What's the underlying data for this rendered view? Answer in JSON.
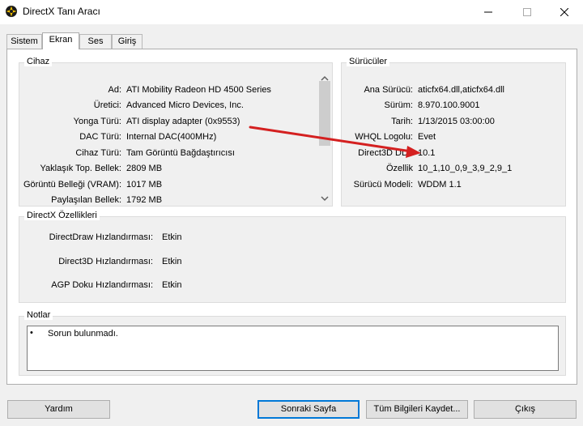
{
  "window": {
    "title": "DirectX Tanı Aracı",
    "icon": "directx-logo-icon"
  },
  "tabs": [
    "Sistem",
    "Ekran",
    "Ses",
    "Giriş"
  ],
  "active_tab": "Ekran",
  "device": {
    "title": "Cihaz",
    "rows": [
      {
        "label": "Ad:",
        "value": "ATI Mobility Radeon HD 4500 Series"
      },
      {
        "label": "Üretici:",
        "value": "Advanced Micro Devices, Inc."
      },
      {
        "label": "Yonga Türü:",
        "value": "ATI display adapter (0x9553)"
      },
      {
        "label": "DAC Türü:",
        "value": "Internal DAC(400MHz)"
      },
      {
        "label": "Cihaz Türü:",
        "value": "Tam Görüntü Bağdaştırıcısı"
      },
      {
        "label": "Yaklaşık Top. Bellek:",
        "value": "2809 MB"
      },
      {
        "label": "Görüntü Belleği (VRAM):",
        "value": "1017 MB"
      },
      {
        "label": "Paylaşılan Bellek:",
        "value": "1792 MB"
      }
    ]
  },
  "drivers": {
    "title": "Sürücüler",
    "rows": [
      {
        "label": "Ana Sürücü:",
        "value": "aticfx64.dll,aticfx64.dll"
      },
      {
        "label": "Sürüm:",
        "value": "8.970.100.9001"
      },
      {
        "label": "Tarih:",
        "value": "1/13/2015 03:00:00"
      },
      {
        "label": "WHQL Logolu:",
        "value": "Evet"
      },
      {
        "label": "Direct3D DDI:",
        "value": "10.1"
      },
      {
        "label": "Özellik",
        "value": "10_1,10_0,9_3,9_2,9_1"
      },
      {
        "label": "Sürücü Modeli:",
        "value": "WDDM 1.1"
      }
    ]
  },
  "features": {
    "title": "DirectX Özellikleri",
    "rows": [
      {
        "label": "DirectDraw Hızlandırması:",
        "value": "Etkin"
      },
      {
        "label": "Direct3D Hızlandırması:",
        "value": "Etkin"
      },
      {
        "label": "AGP Doku Hızlandırması:",
        "value": "Etkin"
      }
    ]
  },
  "notes": {
    "title": "Notlar",
    "items": [
      "Sorun bulunmadı."
    ]
  },
  "buttons": {
    "help": "Yardım",
    "next_page": "Sonraki Sayfa",
    "save_all": "Tüm Bilgileri Kaydet...",
    "exit": "Çıkış"
  },
  "annotation": {
    "color": "#d42020"
  }
}
